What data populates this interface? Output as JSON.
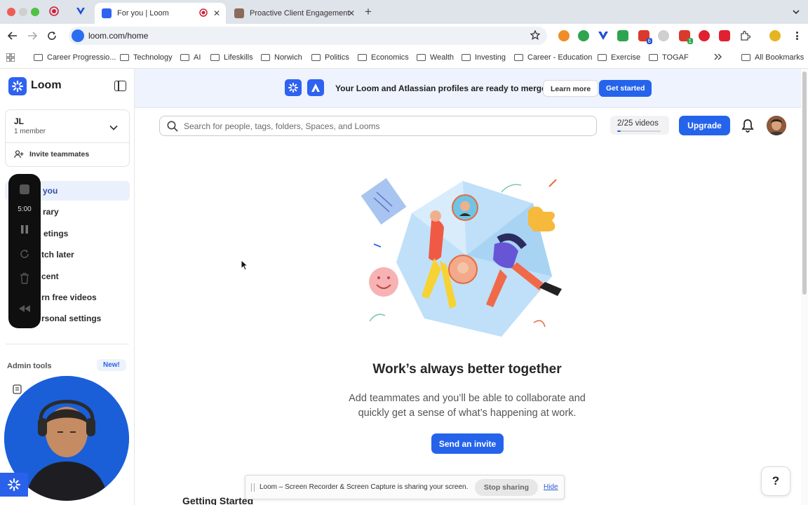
{
  "browser": {
    "tabs": [
      {
        "title": "For you | Loom",
        "active": true
      },
      {
        "title": "Proactive Client Engagement",
        "active": false
      }
    ],
    "url": "loom.com/home",
    "extension_badges": [
      "6",
      "1"
    ],
    "bookmarks": [
      "Career Progressio...",
      "Technology",
      "AI",
      "Lifeskills",
      "Norwich",
      "Politics",
      "Economics",
      "Wealth",
      "Investing",
      "Career - Education",
      "Exercise",
      "TOGAF"
    ],
    "all_bookmarks": "All Bookmarks"
  },
  "sidebar": {
    "logo": "Loom",
    "workspace": {
      "name": "JL",
      "members": "1 member"
    },
    "invite": "Invite teammates",
    "nav": [
      "you",
      "rary",
      "etings",
      "tch later",
      "cent",
      "rn free videos",
      "rsonal settings"
    ],
    "admin_label": "Admin tools",
    "new_badge": "New!"
  },
  "recorder": {
    "time": "5:00"
  },
  "banner": {
    "text": "Your Loom and Atlassian profiles are ready to merge",
    "learn_more": "Learn more",
    "get_started": "Get started"
  },
  "toolbar": {
    "search_placeholder": "Search for people, tags, folders, Spaces, and Looms",
    "quota": "2/25 videos",
    "quota_used_fraction": 0.08,
    "upgrade": "Upgrade"
  },
  "empty_state": {
    "headline": "Work’s always better together",
    "sub": "Add teammates and you’ll be able to collaborate and quickly get a sense of what’s happening at work.",
    "cta": "Send an invite"
  },
  "getting_started": "Getting Started",
  "share_bar": {
    "text": "Loom – Screen Recorder & Screen Capture is sharing your screen.",
    "stop": "Stop sharing",
    "hide": "Hide"
  },
  "help": "?",
  "colors": {
    "accent": "#2563eb",
    "brand": "#2e62f0",
    "nav_active_bg": "#eaf0fc"
  }
}
